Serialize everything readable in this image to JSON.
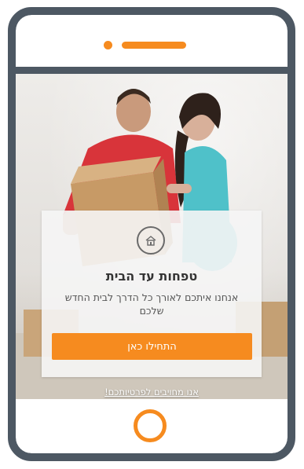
{
  "theme": {
    "accent": "#f68b1f",
    "frame": "#4d5863"
  },
  "device": {
    "camera_icon": "camera-dot",
    "speaker_icon": "speaker-slot",
    "home_button_icon": "home-button-ring"
  },
  "hero": {
    "description": "couple-moving-box-photo"
  },
  "card": {
    "icon": "house-icon",
    "title": "טפחות עד הבית",
    "subtitle": "אנחנו איתכם לאורך כל הדרך לבית החדש שלכם",
    "cta_label": "התחילו כאן"
  },
  "footer": {
    "link_text": "אנו מחויבים לפרטיותכם!"
  }
}
